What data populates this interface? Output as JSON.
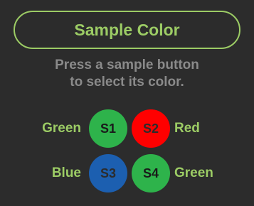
{
  "header": {
    "title": "Sample Color"
  },
  "instructions": {
    "line1": "Press a sample button",
    "line2": "to select its color."
  },
  "samples": [
    {
      "id": "S1",
      "color_name": "Green",
      "fill": "#2eb34b",
      "text_color": "#1a1a1a"
    },
    {
      "id": "S2",
      "color_name": "Red",
      "fill": "#ff0000",
      "text_color": "#2c2c2c"
    },
    {
      "id": "S3",
      "color_name": "Blue",
      "fill": "#1c5fb0",
      "text_color": "#2c2c2c"
    },
    {
      "id": "S4",
      "color_name": "Green",
      "fill": "#2eb34b",
      "text_color": "#1a1a1a"
    }
  ],
  "colors": {
    "accent": "#9ccc65",
    "background": "#2c2c2c",
    "instruction_text": "#8a8a8a"
  }
}
